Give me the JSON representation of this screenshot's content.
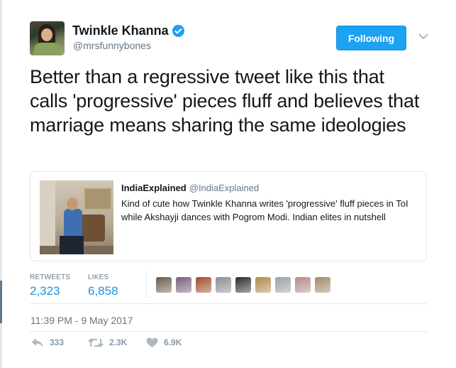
{
  "user": {
    "display_name": "Twinkle Khanna",
    "handle": "@mrsfunnybones",
    "verified": true
  },
  "follow_button": {
    "label": "Following",
    "color": "#1da1f2"
  },
  "tweet_text": "Better than a regressive tweet like this that calls 'progressive' pieces fluff and believes that marriage means sharing the same ideologies",
  "quoted_tweet": {
    "display_name": "IndiaExplained",
    "handle": "@IndiaExplained",
    "text": "Kind of cute how Twinkle Khanna writes  'progressive' fluff pieces in ToI while Akshayji dances with Pogrom Modi. Indian elites in nutshell"
  },
  "stats": {
    "retweets_label": "RETWEETS",
    "retweets_value": "2,323",
    "likes_label": "LIKES",
    "likes_value": "6,858"
  },
  "likers": [
    "#6b5a4a",
    "#7a5c7e",
    "#a04a2a",
    "#8a8e92",
    "#2a2a2a",
    "#b08a4a",
    "#9aa0a6",
    "#b88a8a",
    "#a08a6a"
  ],
  "timestamp": "11:39 PM - 9 May 2017",
  "actions": {
    "reply_count": "333",
    "retweet_count": "2.3K",
    "like_count": "6.9K"
  },
  "icons": [
    "verified-badge-icon",
    "chevron-down-icon",
    "reply-icon",
    "retweet-icon",
    "heart-icon"
  ]
}
